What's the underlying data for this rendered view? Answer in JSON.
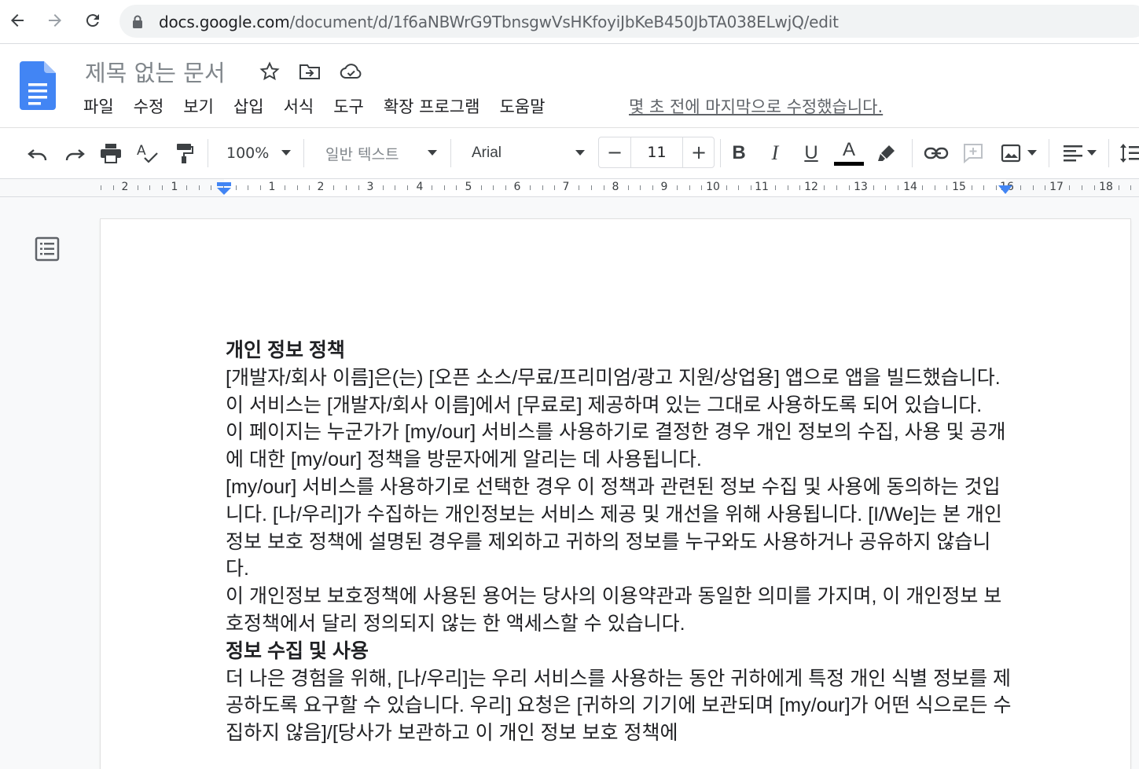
{
  "browser": {
    "url_host": "docs.google.com",
    "url_path": "/document/d/1f6aNBWrG9TbnsgwVsHKfoyiJbKeB450JbTA038ELwjQ/edit"
  },
  "doc": {
    "title": "제목 없는 문서",
    "menus": [
      "파일",
      "수정",
      "보기",
      "삽입",
      "서식",
      "도구",
      "확장 프로그램",
      "도움말"
    ],
    "last_edit": "몇 초 전에 마지막으로 수정했습니다."
  },
  "toolbar": {
    "zoom": "100%",
    "style": "일반 텍스트",
    "font": "Arial",
    "font_size": "11",
    "minus": "−",
    "plus": "+",
    "bold": "B",
    "italic": "I",
    "underline": "U",
    "text_color": "A",
    "text_color_value": "#000000"
  },
  "ruler": {
    "numbers": [
      "2",
      "1",
      "1",
      "2",
      "3",
      "4",
      "5",
      "6",
      "7",
      "8",
      "9",
      "10",
      "11",
      "12",
      "13",
      "14",
      "15",
      "16",
      "17",
      "18"
    ]
  },
  "content": {
    "paragraphs": [
      {
        "text": "개인 정보 정책",
        "bold": true
      },
      {
        "text": "[개발자/회사 이름]은(는) [오픈 소스/무료/프리미엄/광고 지원/상업용] 앱으로 앱을 빌드했습니다. 이 서비스는 [개발자/회사 이름]에서 [무료로] 제공하며 있는 그대로 사용하도록 되어 있습니다.",
        "bold": false
      },
      {
        "text": "이 페이지는 누군가가 [my/our] 서비스를 사용하기로 결정한 경우 개인 정보의 수집, 사용 및 공개에 대한 [my/our] 정책을 방문자에게 알리는 데 사용됩니다.",
        "bold": false
      },
      {
        "text": "[my/our] 서비스를 사용하기로 선택한 경우 이 정책과 관련된 정보 수집 및 사용에 동의하는 것입니다. [나/우리]가 수집하는 개인정보는 서비스 제공 및 개선을 위해 사용됩니다. [I/We]는 본 개인 정보 보호 정책에 설명된 경우를 제외하고 귀하의 정보를 누구와도 사용하거나 공유하지 않습니다.",
        "bold": false
      },
      {
        "text": "이 개인정보 보호정책에 사용된 용어는 당사의 이용약관과 동일한 의미를 가지며, 이 개인정보 보호정책에서 달리 정의되지 않는 한 액세스할 수 있습니다.",
        "bold": false
      },
      {
        "text": "정보 수집 및 사용",
        "bold": true
      },
      {
        "text": "더 나은 경험을 위해, [나/우리]는 우리 서비스를 사용하는 동안 귀하에게 특정 개인 식별 정보를 제공하도록 요구할 수 있습니다. 우리] 요청은 [귀하의 기기에 보관되며 [my/our]가 어떤 식으로든 수집하지 않음]/[당사가 보관하고 이 개인 정보 보호 정책에",
        "bold": false
      }
    ]
  }
}
